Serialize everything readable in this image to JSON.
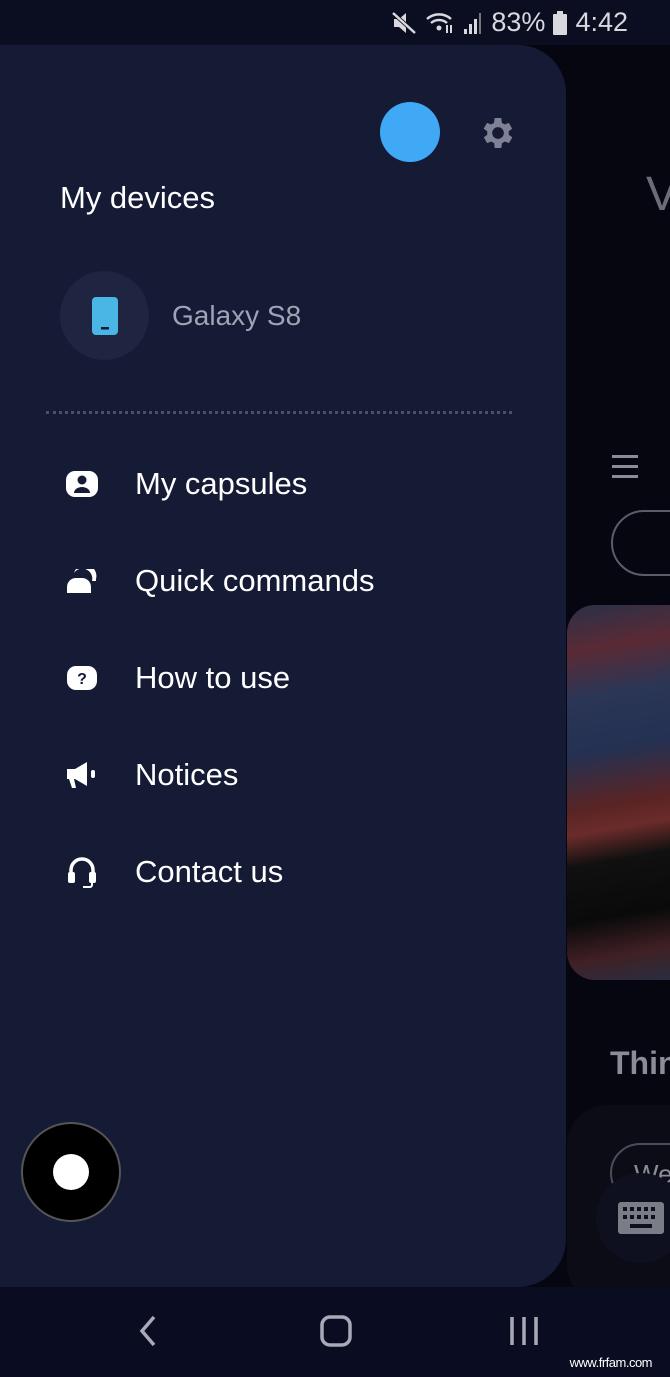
{
  "status_bar": {
    "battery": "83%",
    "time": "4:42",
    "icons": [
      "mute-icon",
      "wifi-icon",
      "signal-icon",
      "battery-icon"
    ]
  },
  "background": {
    "partial_title": "V",
    "section_partial": "Thin",
    "chip_partial": "We"
  },
  "drawer": {
    "title": "My devices",
    "avatar_color": "#3fa9f5",
    "device": {
      "name": "Galaxy S8",
      "icon": "phone-icon",
      "icon_color": "#49b6e5"
    },
    "menu": [
      {
        "label": "My capsules",
        "icon": "capsule-icon"
      },
      {
        "label": "Quick commands",
        "icon": "quick-commands-icon"
      },
      {
        "label": "How to use",
        "icon": "help-icon"
      },
      {
        "label": "Notices",
        "icon": "megaphone-icon"
      },
      {
        "label": "Contact us",
        "icon": "headset-icon"
      }
    ]
  },
  "watermark": "www.frfam.com"
}
